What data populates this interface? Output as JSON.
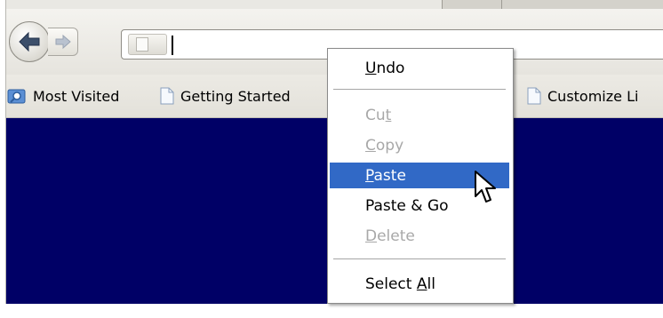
{
  "address_bar": {
    "value": ""
  },
  "bookmarks": [
    {
      "label": "Most Visited",
      "icon": "search-folder-icon"
    },
    {
      "label": "Getting Started",
      "icon": "page-icon"
    },
    {
      "label": "Customize Li",
      "icon": "page-icon"
    }
  ],
  "context_menu": {
    "items": [
      {
        "pre": "",
        "key": "U",
        "post": "ndo",
        "enabled": true,
        "highlighted": false
      },
      {
        "pre": "Cu",
        "key": "t",
        "post": "",
        "enabled": false,
        "highlighted": false
      },
      {
        "pre": "",
        "key": "C",
        "post": "opy",
        "enabled": false,
        "highlighted": false
      },
      {
        "pre": "",
        "key": "P",
        "post": "aste",
        "enabled": true,
        "highlighted": true
      },
      {
        "pre": "Paste & Go",
        "key": "",
        "post": "",
        "enabled": true,
        "highlighted": false
      },
      {
        "pre": "",
        "key": "D",
        "post": "elete",
        "enabled": false,
        "highlighted": false
      },
      {
        "pre": "Select ",
        "key": "A",
        "post": "ll",
        "enabled": true,
        "highlighted": false
      }
    ]
  },
  "colors": {
    "content_background": "#000066",
    "menu_highlight": "#3169c6",
    "menu_disabled_text": "#a8a8a8"
  }
}
